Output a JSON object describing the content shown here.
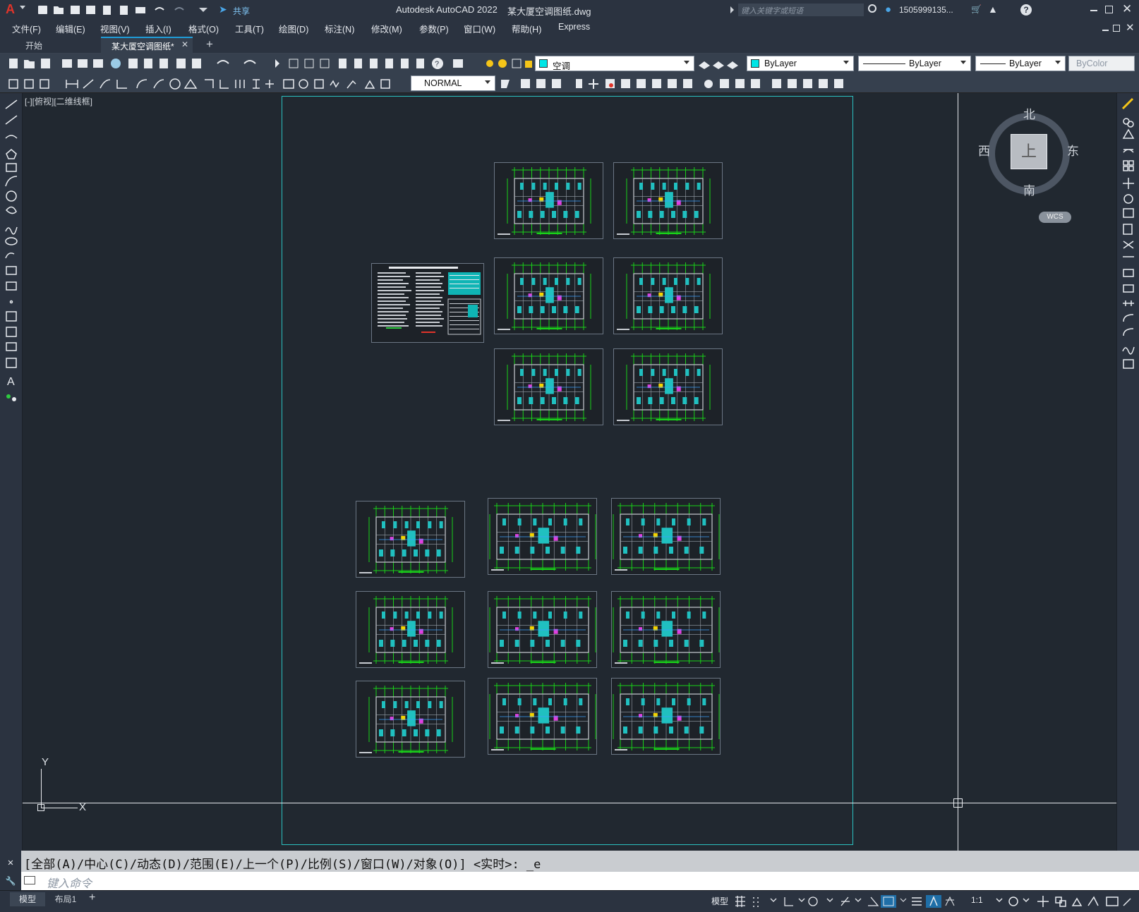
{
  "app": {
    "title": "Autodesk AutoCAD 2022",
    "document": "某大厦空调图纸.dwg",
    "share_label": "共享",
    "search_placeholder": "键入关键字或短语",
    "user": "1505999135..."
  },
  "menu": [
    "文件(F)",
    "编辑(E)",
    "视图(V)",
    "插入(I)",
    "格式(O)",
    "工具(T)",
    "绘图(D)",
    "标注(N)",
    "修改(M)",
    "参数(P)",
    "窗口(W)",
    "帮助(H)",
    "Express"
  ],
  "tabs": {
    "start": "开始",
    "active": "某大厦空调图纸*"
  },
  "toolbar": {
    "layer": "空调",
    "color": "ByLayer",
    "linetype": "ByLayer",
    "lineweight": "ByLayer",
    "plotstyle": "ByColor",
    "dimstyle": "NORMAL"
  },
  "viewport": {
    "label": "[-][俯视][二维线框]"
  },
  "viewcube": {
    "north": "北",
    "south": "南",
    "west": "西",
    "east": "东",
    "face": "上",
    "wcs": "WCS"
  },
  "ucs": {
    "x": "X",
    "y": "Y"
  },
  "command": {
    "history": "[全部(A)/中心(C)/动态(D)/范围(E)/上一个(P)/比例(S)/窗口(W)/对象(O)] <实时>: _e",
    "placeholder": "键入命令"
  },
  "layout_tabs": [
    "模型",
    "布局1"
  ],
  "status": {
    "model": "模型",
    "scale": "1:1"
  },
  "colors": {
    "accent": "#1f9cd8",
    "drawing_cyan": "#20c0c0",
    "drawing_green": "#19d219",
    "titlebar": "#2b3340"
  }
}
